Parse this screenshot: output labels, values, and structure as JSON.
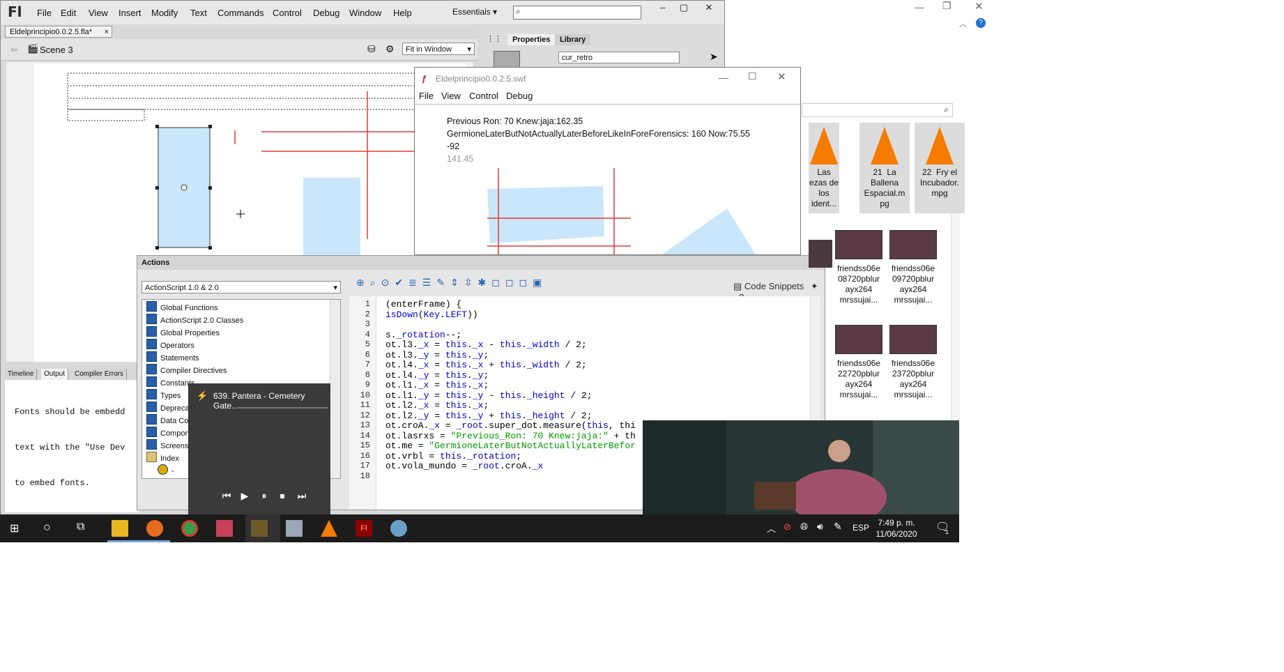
{
  "flash": {
    "logo": "Fl",
    "menu": [
      "File",
      "Edit",
      "View",
      "Insert",
      "Modify",
      "Text",
      "Commands",
      "Control",
      "Debug",
      "Window",
      "Help"
    ],
    "workspace": "Essentials",
    "document_tab": "Eldelprincipio0.0.2.5.fla*",
    "scene": "Scene 3",
    "zoom": "Fit in Window",
    "panel_tabs": [
      "Properties",
      "Library"
    ],
    "instance_name": "cur_retro",
    "bottom_tabs": [
      "Timeline",
      "Output",
      "Compiler Errors"
    ],
    "output_lines": [
      "Fonts should be embedd",
      "text with the \"Use Dev",
      "to embed fonts."
    ]
  },
  "actions": {
    "title": "Actions",
    "version_select": "ActionScript 1.0 & 2.0",
    "tree": [
      "Global Functions",
      "ActionScript 2.0 Classes",
      "Global Properties",
      "Operators",
      "Statements",
      "Compiler Directives",
      "Constants",
      "Types",
      "Deprecated",
      "Data Components",
      "Components",
      "Screens",
      "Index",
      "-"
    ],
    "code_snippets": "Code Snippets",
    "code": [
      {
        "n": "1",
        "t": "(enterFrame) {"
      },
      {
        "n": "2",
        "t": "isDown(Key.LEFT))"
      },
      {
        "n": "3",
        "t": ""
      },
      {
        "n": "4",
        "t": "s._rotation--;"
      },
      {
        "n": "5",
        "t": "ot.l3._x = this._x - this._width / 2;"
      },
      {
        "n": "6",
        "t": "ot.l3._y = this._y;"
      },
      {
        "n": "7",
        "t": "ot.l4._x = this._x + this._width / 2;"
      },
      {
        "n": "8",
        "t": "ot.l4._y = this._y;"
      },
      {
        "n": "9",
        "t": "ot.l1._x = this._x;"
      },
      {
        "n": "10",
        "t": "ot.l1._y = this._y - this._height / 2;"
      },
      {
        "n": "11",
        "t": "ot.l2._x = this._x;"
      },
      {
        "n": "12",
        "t": "ot.l2._y = this._y + this._height / 2;"
      },
      {
        "n": "13",
        "t": "ot.croA._x = _root.super_dot.measure(this, thi"
      },
      {
        "n": "14",
        "t": "ot.lasrxs = \"Previous_Ron: 70 Knew:jaja:\" + th"
      },
      {
        "n": "15",
        "t": "ot.me = \"GermioneLaterButNotActuallyLaterBefor"
      },
      {
        "n": "16",
        "t": "ot.vrbl = this._rotation;"
      },
      {
        "n": "17",
        "t": "ot.vola_mundo = _root.croA._x"
      },
      {
        "n": "18",
        "t": ""
      }
    ]
  },
  "swf": {
    "title": "Eldelprincipio0.0.2.5.swf",
    "menu": [
      "File",
      "View",
      "Control",
      "Debug"
    ],
    "line1": "Previous  Ron: 70 Knew:jaja:162.35",
    "line2": "GermioneLaterButNotActuallyLaterBeforeLikeInForeForensics: 160 Now:75.55",
    "line3": "-92",
    "line4": "141.45"
  },
  "player": {
    "track": "639. Pantera - Cemetery Gate..."
  },
  "explorer": {
    "vlc_files": [
      {
        "num": "",
        "name": "Las\nezas de\nlos\nident..."
      },
      {
        "num": "21",
        "name": "La\nBallena\nEspacial.m\npg"
      },
      {
        "num": "22",
        "name": "Fry el\nIncubador.\nmpg"
      }
    ],
    "video_files": [
      "friendss06e\n08720pblur\nayx264\nmrssujai...",
      "friendss06e\n09720pblur\nayx264\nmrssujai...",
      "friendss06e\n22720pblur\nayx264\nmrssujai...",
      "friendss06e\n23720pblur\nayx264\nmrssujai..."
    ]
  },
  "taskbar": {
    "lang": "ESP",
    "time": "7:49 p. m.",
    "date": "11/06/2020",
    "notif_count": "1"
  },
  "colors": {
    "shape_fill": "#c9e6fb",
    "guide_red": "#e53935",
    "keyword_blue": "#0000cc",
    "string_green": "#009900",
    "taskbar_bg": "#1c1c1c"
  }
}
